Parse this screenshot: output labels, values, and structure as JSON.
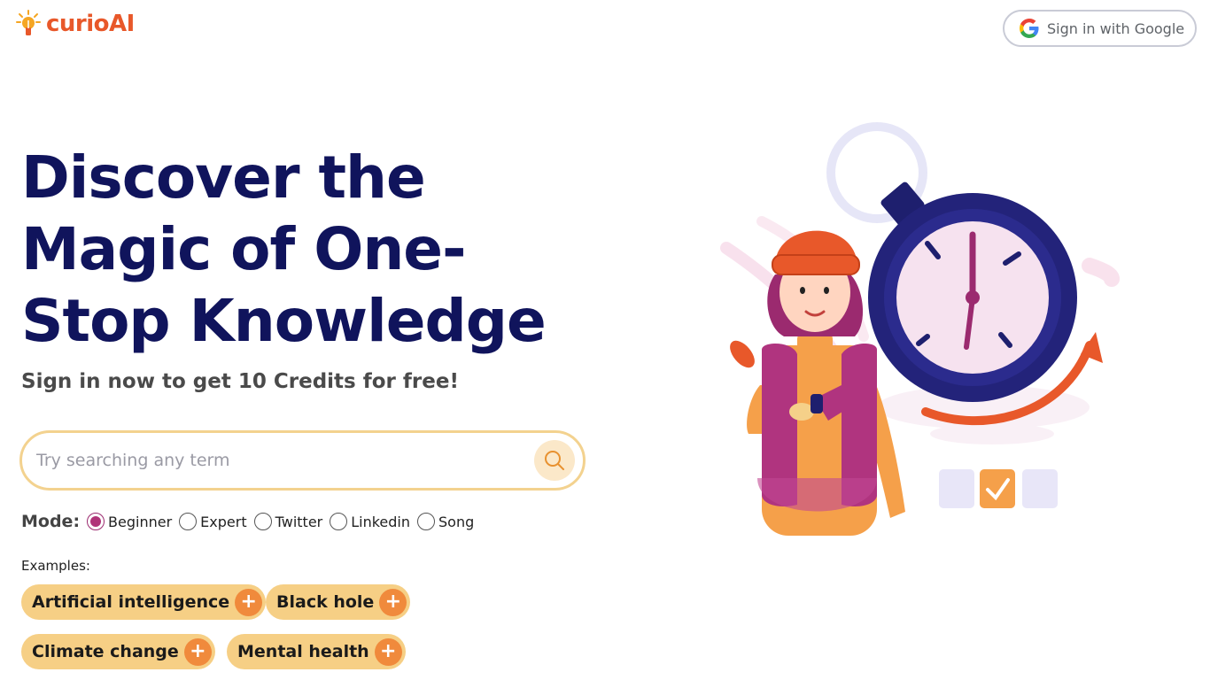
{
  "brand": {
    "name": "curioAI",
    "color": "#e8582a"
  },
  "header": {
    "signin_label": "Sign in with Google",
    "signin_icon": "google-g-icon"
  },
  "hero": {
    "title_lines": [
      "Discover the",
      "Magic of One-",
      "Stop Knowledge"
    ],
    "subtitle": "Sign in now to get 10 Credits for free!"
  },
  "search": {
    "placeholder": "Try searching any term",
    "value": "",
    "icon": "search-icon"
  },
  "mode": {
    "label": "Mode:",
    "options": [
      "Beginner",
      "Expert",
      "Twitter",
      "Linkedin",
      "Song"
    ],
    "selected": "Beginner"
  },
  "examples": {
    "label": "Examples:",
    "items": [
      "Artificial intelligence",
      "Black hole",
      "Climate change",
      "Mental health"
    ]
  },
  "colors": {
    "title": "#10145c",
    "chip": "#f6cf85",
    "chip_plus": "#f08a3c",
    "accent_radio": "#b03479"
  }
}
